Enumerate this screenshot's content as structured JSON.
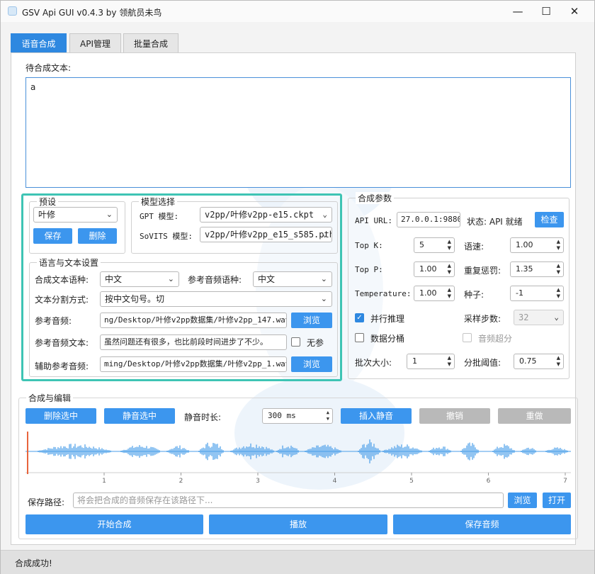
{
  "window": {
    "title": "GSV Api GUI v0.4.3   by  领航员未鸟"
  },
  "tabs": [
    {
      "label": "语音合成"
    },
    {
      "label": "API管理"
    },
    {
      "label": "批量合成"
    }
  ],
  "text_input": {
    "label": "待合成文本:",
    "value": "a"
  },
  "preset": {
    "title": "预设",
    "selected": "叶修",
    "save_label": "保存",
    "delete_label": "删除"
  },
  "model": {
    "title": "模型选择",
    "gpt_label": "GPT 模型:",
    "gpt_value": "v2pp/叶修v2pp-e15.ckpt",
    "sovits_label": "SoVITS 模型:",
    "sovits_value": "v2pp/叶修v2pp_e15_s585.pth"
  },
  "lang_settings": {
    "title": "语言与文本设置",
    "synth_lang_label": "合成文本语种:",
    "synth_lang_value": "中文",
    "ref_lang_label": "参考音频语种:",
    "ref_lang_value": "中文",
    "split_label": "文本分割方式:",
    "split_value": "按中文句号。切",
    "ref_audio_label": "参考音频:",
    "ref_audio_value": "ng/Desktop/叶修v2pp数据集/叶修v2pp_147.wav",
    "browse_label": "浏览",
    "ref_text_label": "参考音频文本:",
    "ref_text_value": "虽然问题还有很多，也比前段时间进步了不少。",
    "no_ref_label": "无参",
    "aux_ref_label": "辅助参考音频:",
    "aux_ref_value": "ming/Desktop/叶修v2pp数据集/叶修v2pp_1.wav",
    "aux_browse_label": "浏览"
  },
  "params": {
    "title": "合成参数",
    "api_url_label": "API URL:",
    "api_url_value": "27.0.0.1:9880",
    "status_label": "状态: API 就绪",
    "check_label": "检查",
    "topk_label": "Top K:",
    "topk_value": "5",
    "speed_label": "语速:",
    "speed_value": "1.00",
    "topp_label": "Top P:",
    "topp_value": "1.00",
    "rep_label": "重复惩罚:",
    "rep_value": "1.35",
    "temp_label": "Temperature:",
    "temp_value": "1.00",
    "seed_label": "种子:",
    "seed_value": "-1",
    "parallel_label": "并行推理",
    "steps_label": "采样步数:",
    "steps_value": "32",
    "bucket_label": "数据分桶",
    "sr_label": "音频超分",
    "batch_label": "批次大小:",
    "batch_value": "1",
    "threshold_label": "分批阈值:",
    "threshold_value": "0.75"
  },
  "edit": {
    "title": "合成与编辑",
    "delete_sel_label": "删除选中",
    "mute_sel_label": "静音选中",
    "silence_len_label": "静音时长:",
    "silence_value": "300 ms",
    "insert_silence_label": "插入静音",
    "undo_label": "撤销",
    "redo_label": "重做",
    "timeline_ticks": [
      "1",
      "2",
      "3",
      "4",
      "5",
      "6",
      "7"
    ],
    "waveform_color": "#4a9ee8",
    "cursor_color": "#e8643c"
  },
  "save": {
    "path_label": "保存路径:",
    "path_placeholder": "将会把合成的音频保存在该路径下...",
    "browse_label": "浏览",
    "open_label": "打开"
  },
  "actions": {
    "start_label": "开始合成",
    "play_label": "播放",
    "save_label": "保存音频"
  },
  "status_bar": {
    "text": "合成成功!"
  },
  "colors": {
    "accent": "#2e88e0",
    "highlight": "#3ec4b4"
  }
}
